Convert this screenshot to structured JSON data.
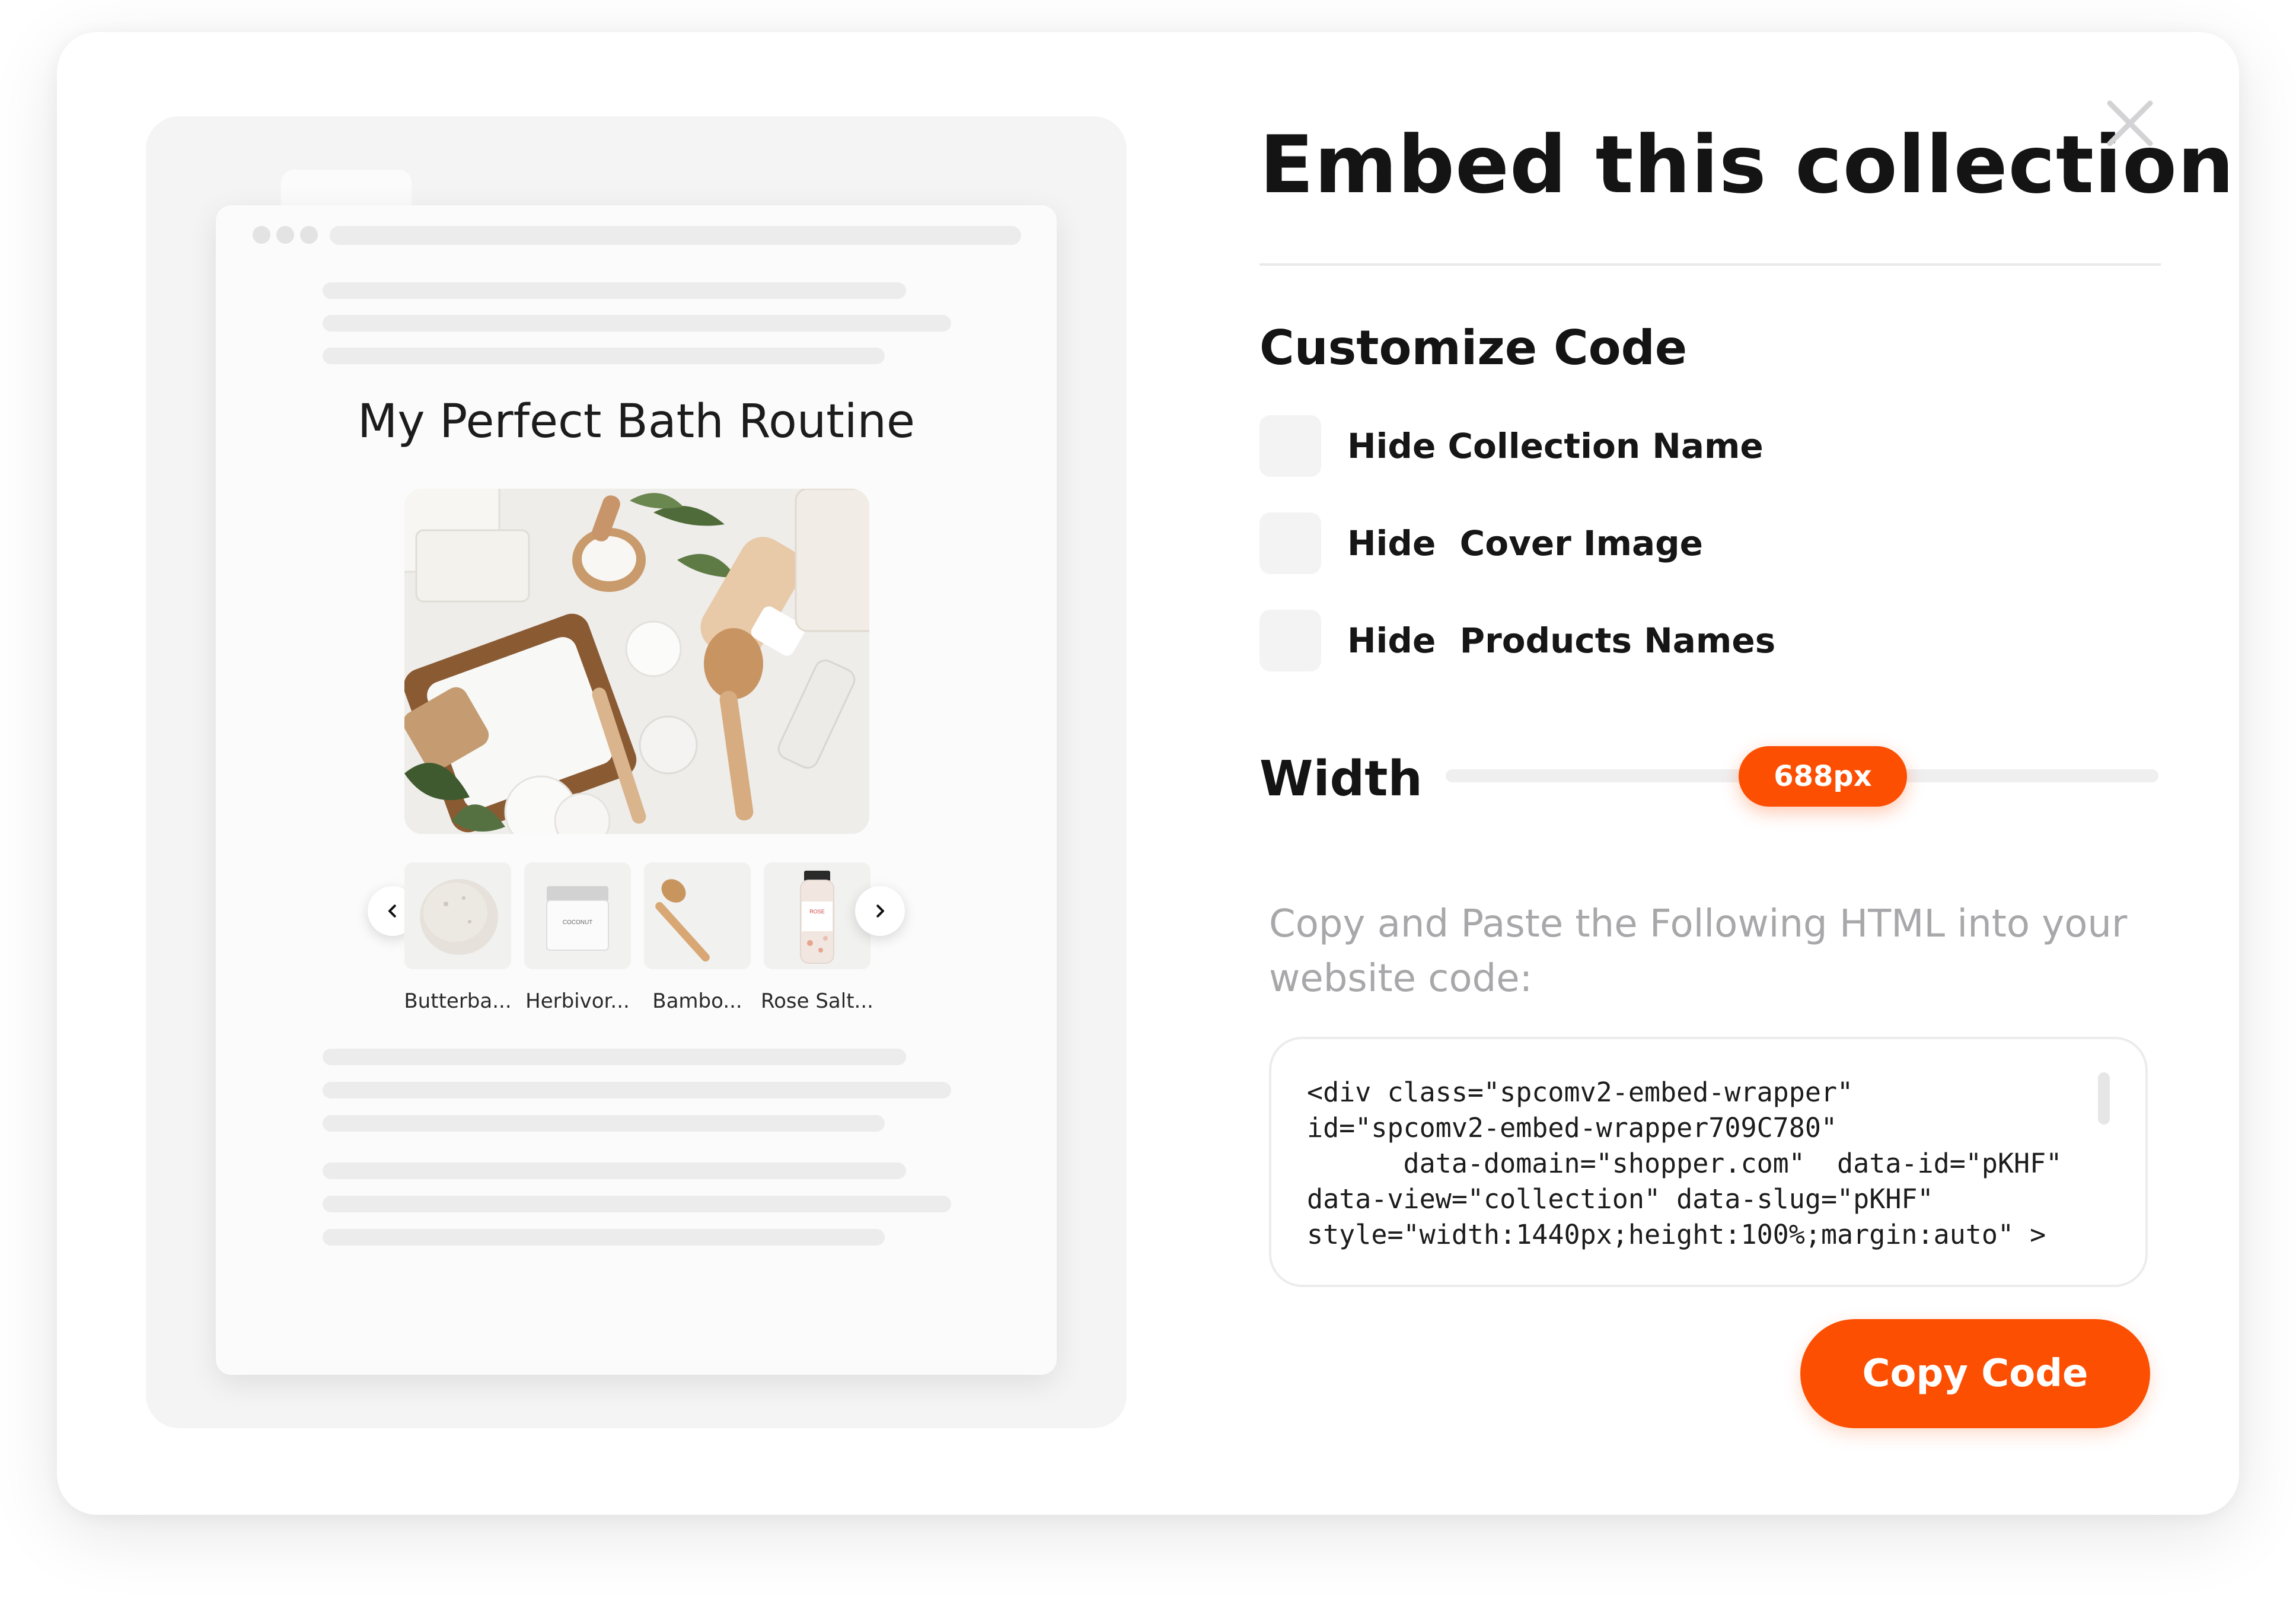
{
  "preview": {
    "title": "My Perfect Bath Routine",
    "cover_image": "bath-products-flatlay",
    "products": [
      {
        "name": "Butterba...",
        "icon": "soap-bar"
      },
      {
        "name": "Herbivor...",
        "icon": "jar",
        "jar_text": "COCONUT"
      },
      {
        "name": "Bambo...",
        "icon": "bath-brush"
      },
      {
        "name": "Rose Salt...",
        "icon": "salt-bottle",
        "bottle_text": "ROSE"
      }
    ]
  },
  "panel": {
    "title": "Embed this collection",
    "section_title": "Customize Code",
    "options": [
      {
        "label": "Hide Collection Name",
        "checked": false
      },
      {
        "label": "Hide  Cover Image",
        "checked": false
      },
      {
        "label": "Hide  Products Names",
        "checked": false
      }
    ],
    "width_label": "Width",
    "width_value": "688px",
    "instructions": "Copy and Paste the Following HTML into your website code:",
    "code": "<div class=\"spcomv2-embed-wrapper\"\nid=\"spcomv2-embed-wrapper709C780\"\n      data-domain=\"shopper.com\"  data-id=\"pKHF\"\ndata-view=\"collection\" data-slug=\"pKHF\"\nstyle=\"width:1440px;height:100%;margin:auto\" >",
    "copy_button": "Copy Code"
  },
  "colors": {
    "accent": "#fc4f02",
    "text": "#141414",
    "muted": "#a8a8ab"
  }
}
